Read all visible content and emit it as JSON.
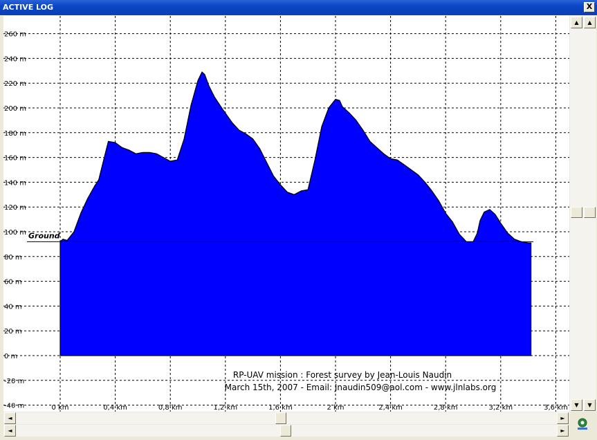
{
  "window": {
    "title": "ACTIVE LOG",
    "close_label": "X"
  },
  "chart_data": {
    "type": "area",
    "title": "",
    "annotations": [
      "RP-UAV mission : Forest survey by Jean-Louis Naudin",
      "March 15th, 2007 - Email: Jnaudin509@aol.com - www.jlnlabs.org"
    ],
    "ground_label": "Ground",
    "ground_level": 92,
    "xlabel": "",
    "ylabel": "",
    "x_unit": "km",
    "y_unit": "m",
    "xlim": [
      -0.4,
      3.65
    ],
    "ylim": [
      -40,
      272
    ],
    "x_ticks": [
      0,
      0.4,
      0.8,
      1.2,
      1.6,
      2,
      2.4,
      2.8,
      3.2,
      3.6
    ],
    "x_tick_labels": [
      "0 km",
      "0,4 km",
      "0,8 km",
      "1,2 km",
      "1,6 km",
      "2 km",
      "2,4 km",
      "2,8 km",
      "3,2 km",
      "3,6 km"
    ],
    "y_ticks": [
      -40,
      -20,
      0,
      20,
      40,
      60,
      80,
      100,
      120,
      140,
      160,
      180,
      200,
      220,
      240,
      260
    ],
    "y_tick_labels": [
      "-40 m",
      "-20 m",
      "0 m",
      "20 m",
      "40 m",
      "60 m",
      "80 m",
      "100 m",
      "120 m",
      "140 m",
      "160 m",
      "180 m",
      "200 m",
      "220 m",
      "240 m",
      "260 m"
    ],
    "grid": true,
    "fill_color": "#0000ff",
    "series": [
      {
        "x": [
          0,
          0.02,
          0.05,
          0.1,
          0.15,
          0.2,
          0.25,
          0.28,
          0.32,
          0.35,
          0.4,
          0.45,
          0.5,
          0.55,
          0.6,
          0.65,
          0.7,
          0.75,
          0.8,
          0.85,
          0.9,
          0.95,
          1.0,
          1.03,
          1.05,
          1.08,
          1.12,
          1.18,
          1.25,
          1.3,
          1.35,
          1.4,
          1.45,
          1.5,
          1.55,
          1.6,
          1.65,
          1.7,
          1.75,
          1.8,
          1.85,
          1.9,
          1.95,
          2.0,
          2.03,
          2.05,
          2.1,
          2.15,
          2.2,
          2.25,
          2.3,
          2.35,
          2.4,
          2.45,
          2.5,
          2.55,
          2.6,
          2.65,
          2.7,
          2.75,
          2.8,
          2.85,
          2.9,
          2.95,
          3.0,
          3.03,
          3.05,
          3.08,
          3.12,
          3.16,
          3.2,
          3.25,
          3.3,
          3.35,
          3.4,
          3.42
        ],
        "y": [
          92,
          94,
          93,
          100,
          115,
          127,
          137,
          142,
          160,
          173,
          172,
          168,
          166,
          163,
          164,
          164,
          163,
          160,
          157,
          158,
          175,
          202,
          222,
          229,
          227,
          218,
          209,
          199,
          188,
          182,
          179,
          175,
          167,
          156,
          145,
          138,
          132,
          130,
          133,
          134,
          158,
          185,
          200,
          207,
          206,
          201,
          196,
          190,
          182,
          173,
          168,
          163,
          159,
          158,
          154,
          150,
          146,
          140,
          133,
          125,
          115,
          108,
          98,
          92,
          92,
          99,
          109,
          116,
          118,
          114,
          107,
          99,
          94,
          92,
          91,
          91
        ]
      }
    ]
  },
  "scrollbars": {
    "up_arrow": "▲",
    "down_arrow": "▼",
    "left_arrow": "◄",
    "right_arrow": "►"
  }
}
